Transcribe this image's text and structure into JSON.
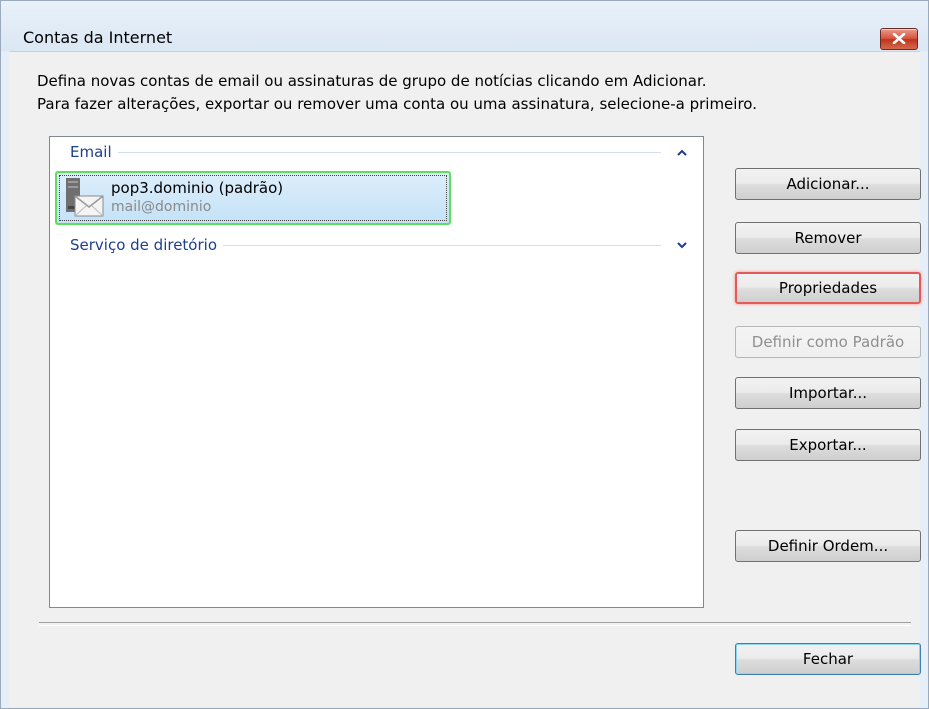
{
  "window": {
    "title": "Contas da Internet",
    "close_icon": "close-x-icon"
  },
  "description": {
    "line1": "Defina novas contas de email ou assinaturas de grupo de notícias clicando em Adicionar.",
    "line2": "Para fazer alterações, exportar ou remover uma conta ou uma assinatura, selecione-a primeiro."
  },
  "list": {
    "groups": [
      {
        "label": "Email",
        "chevron": "chevron-up-icon",
        "items": [
          {
            "name": "pop3.dominio (padrão)",
            "email": "mail@dominio",
            "icon": "mail-account-icon",
            "selected": true
          }
        ]
      },
      {
        "label": "Serviço de diretório",
        "chevron": "chevron-down-icon",
        "items": []
      }
    ]
  },
  "buttons": {
    "add": "Adicionar...",
    "remove": "Remover",
    "properties": "Propriedades",
    "set_default": "Definir como Padrão",
    "import": "Importar...",
    "export": "Exportar...",
    "set_order": "Definir Ordem...",
    "close": "Fechar"
  },
  "colors": {
    "group_label": "#1e3f8a",
    "selection_border": "#5ce05c",
    "highlight_border": "#e25b5b"
  }
}
